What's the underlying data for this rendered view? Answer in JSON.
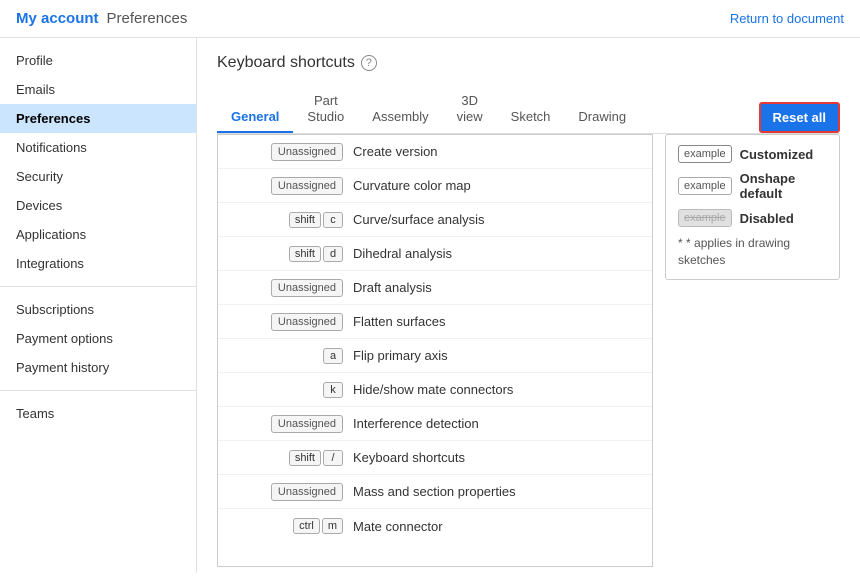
{
  "header": {
    "myaccount": "My account",
    "page": "Preferences",
    "return_link": "Return to document"
  },
  "sidebar": {
    "items": [
      {
        "id": "profile",
        "label": "Profile",
        "active": false
      },
      {
        "id": "emails",
        "label": "Emails",
        "active": false
      },
      {
        "id": "preferences",
        "label": "Preferences",
        "active": true
      },
      {
        "id": "notifications",
        "label": "Notifications",
        "active": false
      },
      {
        "id": "security",
        "label": "Security",
        "active": false
      },
      {
        "id": "devices",
        "label": "Devices",
        "active": false
      },
      {
        "id": "applications",
        "label": "Applications",
        "active": false
      },
      {
        "id": "integrations",
        "label": "Integrations",
        "active": false
      },
      {
        "id": "subscriptions",
        "label": "Subscriptions",
        "active": false
      },
      {
        "id": "payment_options",
        "label": "Payment options",
        "active": false
      },
      {
        "id": "payment_history",
        "label": "Payment history",
        "active": false
      },
      {
        "id": "teams",
        "label": "Teams",
        "active": false
      }
    ]
  },
  "main": {
    "section_title": "Keyboard shortcuts",
    "tabs": [
      {
        "id": "general",
        "label": "General",
        "active": true
      },
      {
        "id": "part_studio",
        "label": "Part\nStudio",
        "active": false
      },
      {
        "id": "assembly",
        "label": "Assembly",
        "active": false
      },
      {
        "id": "3d_view",
        "label": "3D\nview",
        "active": false
      },
      {
        "id": "sketch",
        "label": "Sketch",
        "active": false
      },
      {
        "id": "drawing",
        "label": "Drawing",
        "active": false
      }
    ],
    "reset_btn": "Reset all",
    "shortcuts": [
      {
        "keys": [
          "Unassigned"
        ],
        "action": "Create version",
        "type": "unassigned"
      },
      {
        "keys": [
          "Unassigned"
        ],
        "action": "Curvature color map",
        "type": "unassigned"
      },
      {
        "keys": [
          "shift",
          "c"
        ],
        "action": "Curve/surface analysis",
        "type": "keys"
      },
      {
        "keys": [
          "shift",
          "d"
        ],
        "action": "Dihedral analysis",
        "type": "keys"
      },
      {
        "keys": [
          "Unassigned"
        ],
        "action": "Draft analysis",
        "type": "unassigned"
      },
      {
        "keys": [
          "Unassigned"
        ],
        "action": "Flatten surfaces",
        "type": "unassigned"
      },
      {
        "keys": [
          "a"
        ],
        "action": "Flip primary axis",
        "type": "keys"
      },
      {
        "keys": [
          "k"
        ],
        "action": "Hide/show mate connectors",
        "type": "keys"
      },
      {
        "keys": [
          "Unassigned"
        ],
        "action": "Interference detection",
        "type": "unassigned"
      },
      {
        "keys": [
          "shift",
          "/"
        ],
        "action": "Keyboard shortcuts",
        "type": "keys"
      },
      {
        "keys": [
          "Unassigned"
        ],
        "action": "Mass and section properties",
        "type": "unassigned"
      },
      {
        "keys": [
          "ctrl",
          "m"
        ],
        "action": "Mate connector",
        "type": "keys"
      }
    ],
    "legend": {
      "items": [
        {
          "style": "customized",
          "example": "example",
          "label": "Customized"
        },
        {
          "style": "onshape",
          "example": "example",
          "label": "Onshape default"
        },
        {
          "style": "disabled",
          "example": "example",
          "label": "Disabled"
        }
      ],
      "note": "* applies in drawing sketches"
    }
  }
}
